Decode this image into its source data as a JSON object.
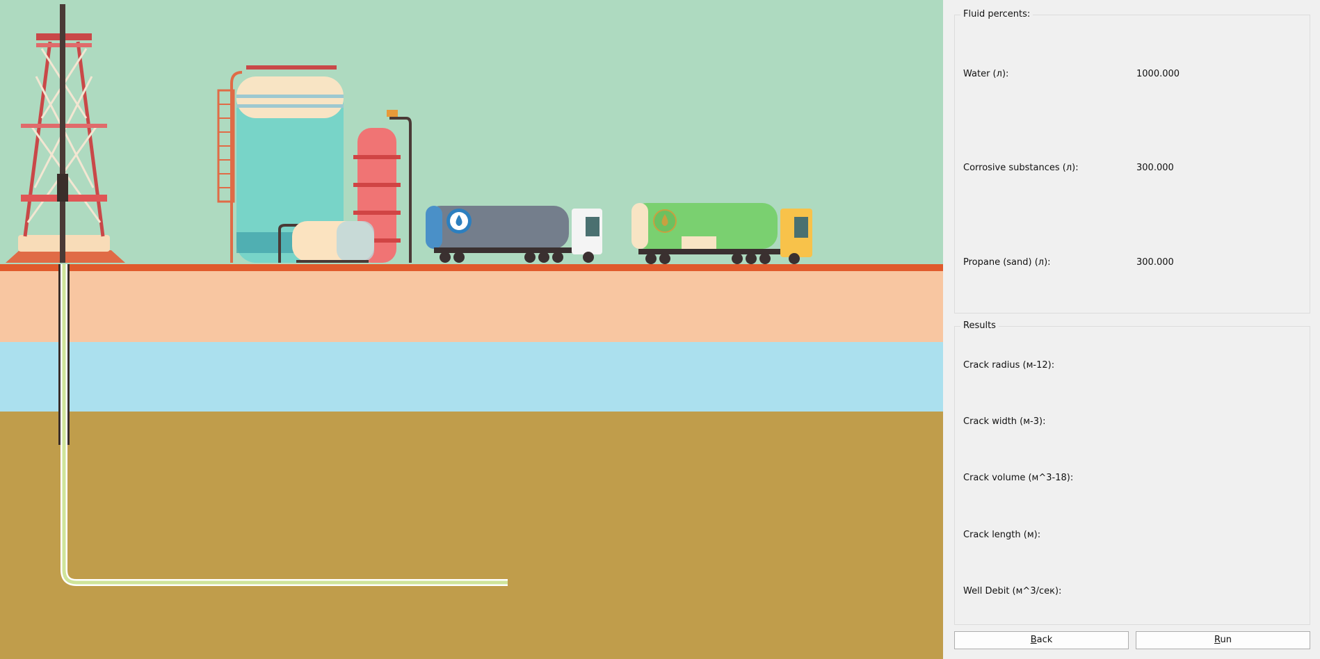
{
  "colors": {
    "sky": "#aedac0",
    "ground_line": "#e05a2c",
    "soil_layer": "#f8c6a1",
    "water_layer": "#abe0ee",
    "rock_layer": "#c09d4b",
    "pipe": "#d8e8a0",
    "panel_bg": "#f0f0f0"
  },
  "scene": {
    "icons": [
      "drilling-rig",
      "storage-tank",
      "distillation-column",
      "small-tank",
      "water-tanker-truck",
      "oil-tanker-truck",
      "well-pipe"
    ]
  },
  "fluid": {
    "title": "Fluid percents:",
    "rows": [
      {
        "label": "Water (л):",
        "value": "1000.000"
      },
      {
        "label": "Corrosive substances (л):",
        "value": "300.000"
      },
      {
        "label": "Propane (sand) (л):",
        "value": "300.000"
      }
    ]
  },
  "results": {
    "title": "Results",
    "rows": [
      {
        "label": "Crack radius (м-12):",
        "value": ""
      },
      {
        "label": "Crack width (м-3):",
        "value": ""
      },
      {
        "label": "Crack volume (м^3-18):",
        "value": ""
      },
      {
        "label": "Crack length (м):",
        "value": ""
      },
      {
        "label": "Well Debit (м^3/сек):",
        "value": ""
      }
    ]
  },
  "buttons": {
    "back": {
      "mnemonic": "B",
      "rest": "ack"
    },
    "run": {
      "mnemonic": "R",
      "rest": "un"
    }
  }
}
